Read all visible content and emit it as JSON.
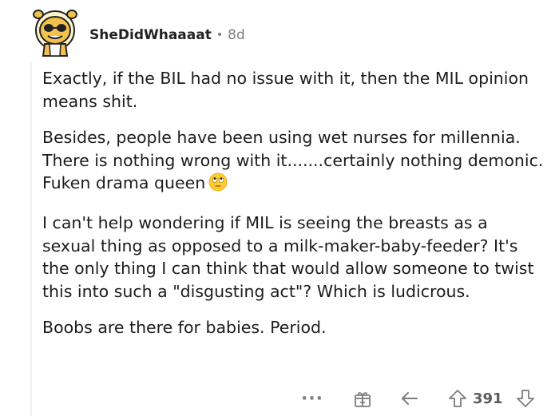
{
  "comment": {
    "author": "SheDidWhaaaat",
    "separator": "•",
    "age": "8d",
    "paragraphs": [
      "Exactly, if the BIL had no issue with it, then the MIL opinion means shit.",
      "Besides, people have been using wet nurses for millennia. There is nothing wrong with it.......certainly nothing demonic. Fuken drama queen",
      "I can't help wondering if MIL is seeing the breasts as a sexual thing as opposed to a milk-maker-baby-feeder? It's the only thing I can think that would allow someone to twist this into such a \"disgusting act\"? Which is ludicrous.",
      "Boobs are there for babies. Period."
    ],
    "emoji": "face-with-rolling-eyes"
  },
  "actions": {
    "more": "···",
    "award_icon": "award-icon",
    "reply_icon": "reply-icon",
    "upvote_icon": "upvote-arrow-icon",
    "score": "391",
    "downvote_icon": "downvote-arrow-icon"
  },
  "colors": {
    "text": "#1c1c1c",
    "meta": "#7c7c7c",
    "icon": "#5c5c5c"
  }
}
